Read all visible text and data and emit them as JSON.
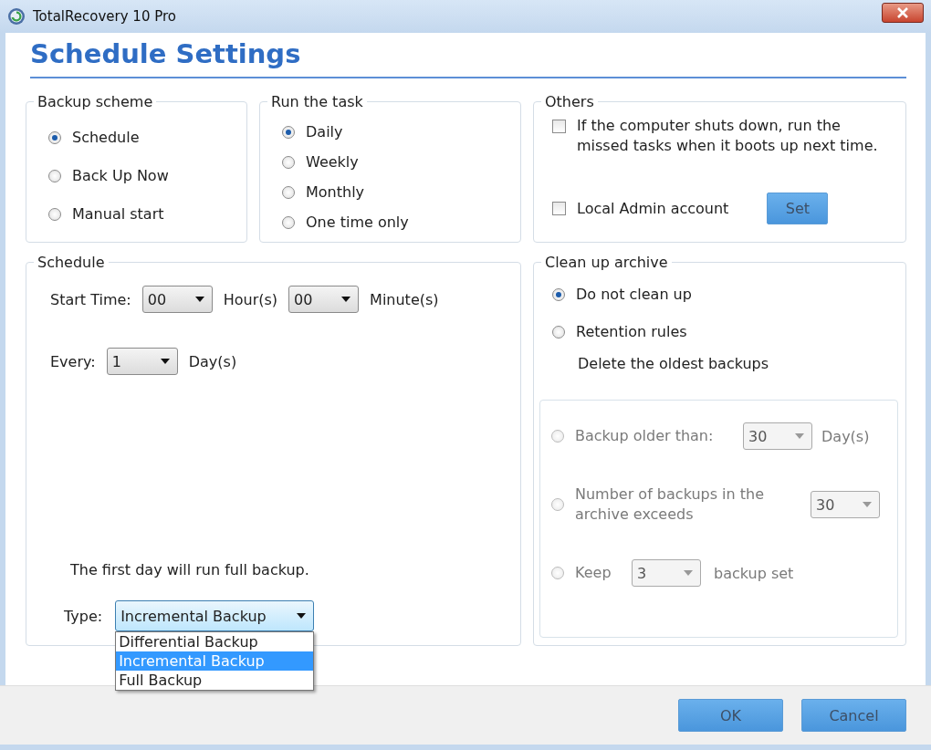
{
  "window": {
    "title": "TotalRecovery 10 Pro"
  },
  "header": "Schedule Settings",
  "backup_scheme": {
    "title": "Backup scheme",
    "options": [
      {
        "label": "Schedule",
        "selected": true
      },
      {
        "label": "Back Up Now",
        "selected": false
      },
      {
        "label": "Manual start",
        "selected": false
      }
    ]
  },
  "run_the_task": {
    "title": "Run the task",
    "options": [
      {
        "label": "Daily",
        "selected": true
      },
      {
        "label": "Weekly",
        "selected": false
      },
      {
        "label": "Monthly",
        "selected": false
      },
      {
        "label": "One time only",
        "selected": false
      }
    ]
  },
  "others": {
    "title": "Others",
    "options": [
      {
        "label": "If the computer shuts down, run the missed tasks when it boots up next time.",
        "checked": false
      },
      {
        "label": "Local Admin account",
        "checked": false
      }
    ],
    "set_button": "Set"
  },
  "schedule": {
    "title": "Schedule",
    "start_time": {
      "label": "Start Time:",
      "hour": "00",
      "hour_unit": "Hour(s)",
      "minute": "00",
      "minute_unit": "Minute(s)"
    },
    "every": {
      "label": "Every:",
      "value": "1",
      "unit": "Day(s)"
    },
    "note": "The first day will run full backup.",
    "type": {
      "label": "Type:",
      "value": "Incremental Backup",
      "expanded": true,
      "options": [
        {
          "label": "Differential Backup",
          "selected": false
        },
        {
          "label": "Incremental Backup",
          "selected": true
        },
        {
          "label": "Full Backup",
          "selected": false
        }
      ]
    }
  },
  "clean_up": {
    "title": "Clean up archive",
    "options": [
      {
        "label": "Do not clean up",
        "selected": true
      },
      {
        "label": "Retention rules",
        "selected": false
      }
    ],
    "subtitle": "Delete the oldest backups",
    "rules": {
      "disabled": true,
      "items": [
        {
          "kind": "older",
          "label": "Backup older than:",
          "value": "30",
          "unit": "Day(s)",
          "selected": false
        },
        {
          "kind": "count",
          "label": "Number of backups in the archive exceeds",
          "value": "30",
          "selected": false
        },
        {
          "kind": "keep",
          "label": "Keep",
          "value": "3",
          "unit": "backup set",
          "selected": false
        }
      ]
    }
  },
  "buttons": [
    "OK",
    "Cancel"
  ]
}
